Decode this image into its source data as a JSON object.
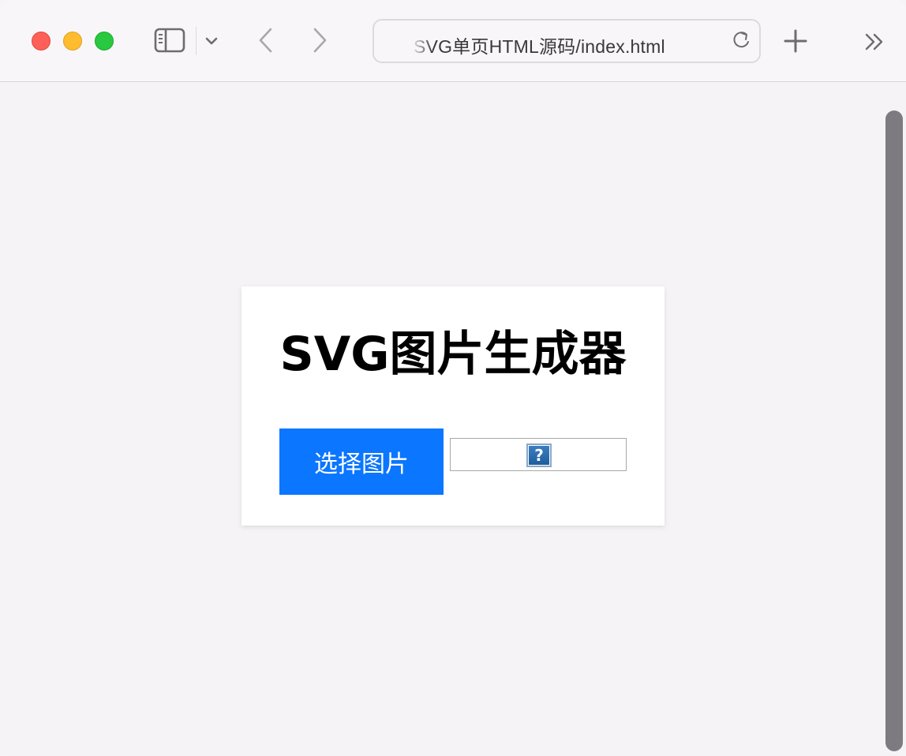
{
  "browser": {
    "url_text": "SVG单页HTML源码/index.html",
    "icons": {
      "sidebar": "sidebar-icon",
      "chevron": "chevron-down-icon",
      "back": "back-arrow-icon",
      "forward": "forward-arrow-icon",
      "reload": "reload-icon",
      "new_tab": "plus-icon",
      "more": "double-chevron-right-icon"
    },
    "colors": {
      "close": "#fe5f57",
      "minimize": "#febc2e",
      "zoom": "#28c840"
    }
  },
  "page": {
    "title": "SVG图片生成器",
    "select_button_label": "选择图片",
    "preview_placeholder_glyph": "?",
    "accent_color": "#0b76ff"
  }
}
